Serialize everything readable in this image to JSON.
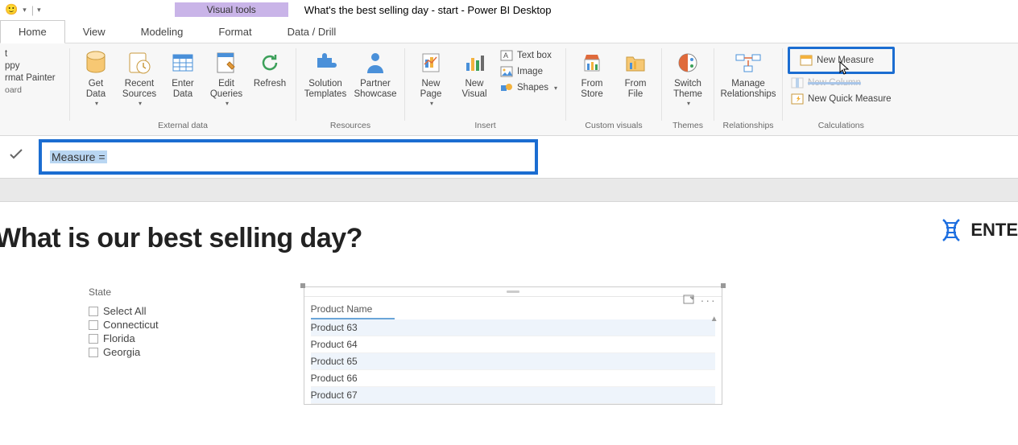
{
  "titlebar": {
    "doc_title": "What's the best selling day - start - Power BI Desktop",
    "contextual_tab": "Visual tools"
  },
  "tabs": {
    "home": "Home",
    "view": "View",
    "modeling": "Modeling",
    "format": "Format",
    "data_drill": "Data / Drill"
  },
  "ribbon": {
    "clipboard": {
      "cut": "t",
      "copy": "ppy",
      "paint": "rmat Painter",
      "group": "oard"
    },
    "external": {
      "get_data": "Get\nData",
      "recent": "Recent\nSources",
      "enter": "Enter\nData",
      "edit_q": "Edit\nQueries",
      "refresh": "Refresh",
      "group": "External data"
    },
    "resources": {
      "sol": "Solution\nTemplates",
      "partner": "Partner\nShowcase",
      "group": "Resources"
    },
    "insert": {
      "new_page": "New\nPage",
      "new_visual": "New\nVisual",
      "textbox": "Text box",
      "image": "Image",
      "shapes": "Shapes",
      "group": "Insert"
    },
    "custom": {
      "store": "From\nStore",
      "file": "From\nFile",
      "group": "Custom visuals"
    },
    "themes": {
      "switch": "Switch\nTheme",
      "group": "Themes"
    },
    "relationships": {
      "manage": "Manage\nRelationships",
      "group": "Relationships"
    },
    "calculations": {
      "new_measure": "New Measure",
      "new_column": "New Column",
      "new_quick": "New Quick Measure",
      "group": "Calculations"
    }
  },
  "formula": {
    "text": "Measure ="
  },
  "report": {
    "title": "What is our best selling day?",
    "brand": "ENTE",
    "slicer": {
      "label": "State",
      "items": [
        "Select All",
        "Connecticut",
        "Florida",
        "Georgia"
      ]
    },
    "table": {
      "header": "Product Name",
      "rows": [
        "Product 63",
        "Product 64",
        "Product 65",
        "Product 66",
        "Product 67"
      ]
    }
  }
}
